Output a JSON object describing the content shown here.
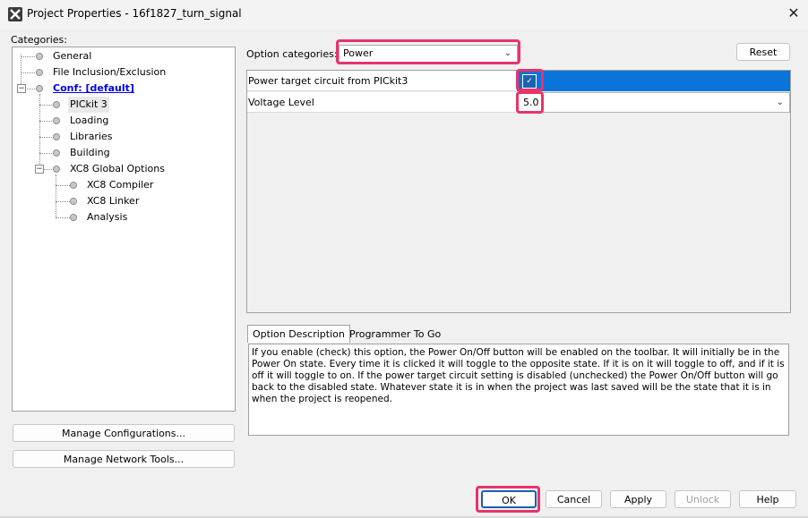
{
  "window": {
    "title": "Project Properties - 16f1827_turn_signal",
    "close_symbol": "✕"
  },
  "categories": {
    "label": "Categories:",
    "items": [
      {
        "label": "General"
      },
      {
        "label": "File Inclusion/Exclusion"
      },
      {
        "label": "Conf: [default]"
      },
      {
        "label": "PICkit 3"
      },
      {
        "label": "Loading"
      },
      {
        "label": "Libraries"
      },
      {
        "label": "Building"
      },
      {
        "label": "XC8 Global Options"
      },
      {
        "label": "XC8 Compiler"
      },
      {
        "label": "XC8 Linker"
      },
      {
        "label": "Analysis"
      }
    ],
    "selected": "PICkit 3"
  },
  "left_buttons": {
    "manage_configurations": "Manage Configurations...",
    "manage_network_tools": "Manage Network Tools..."
  },
  "options": {
    "category_label": "Option categories:",
    "category_value": "Power",
    "reset_label": "Reset",
    "rows": [
      {
        "name": "Power target circuit from PICkit3",
        "type": "checkbox",
        "checked": true
      },
      {
        "name": "Voltage Level",
        "type": "select",
        "value": "5.0"
      }
    ]
  },
  "tabs": [
    {
      "label": "Option Description",
      "active": true
    },
    {
      "label": "Programmer To Go",
      "active": false
    }
  ],
  "description": "If you enable (check) this option, the Power On/Off button will be enabled on the toolbar. It will initially be in the Power On state. Every time it is clicked it will toggle to the opposite state. If it is on it will toggle to off, and if it is off it will toggle to on. If the power target circuit setting is disabled (unchecked) the Power On/Off button will go back to the disabled state. Whatever state it is in when the project was last saved will be the state that it is in when the project is reopened.",
  "footer": {
    "ok": "OK",
    "cancel": "Cancel",
    "apply": "Apply",
    "unlock": "Unlock",
    "help": "Help"
  },
  "colors": {
    "highlight": "#e8336b",
    "selection": "#0a74da",
    "link": "#0000ee"
  }
}
